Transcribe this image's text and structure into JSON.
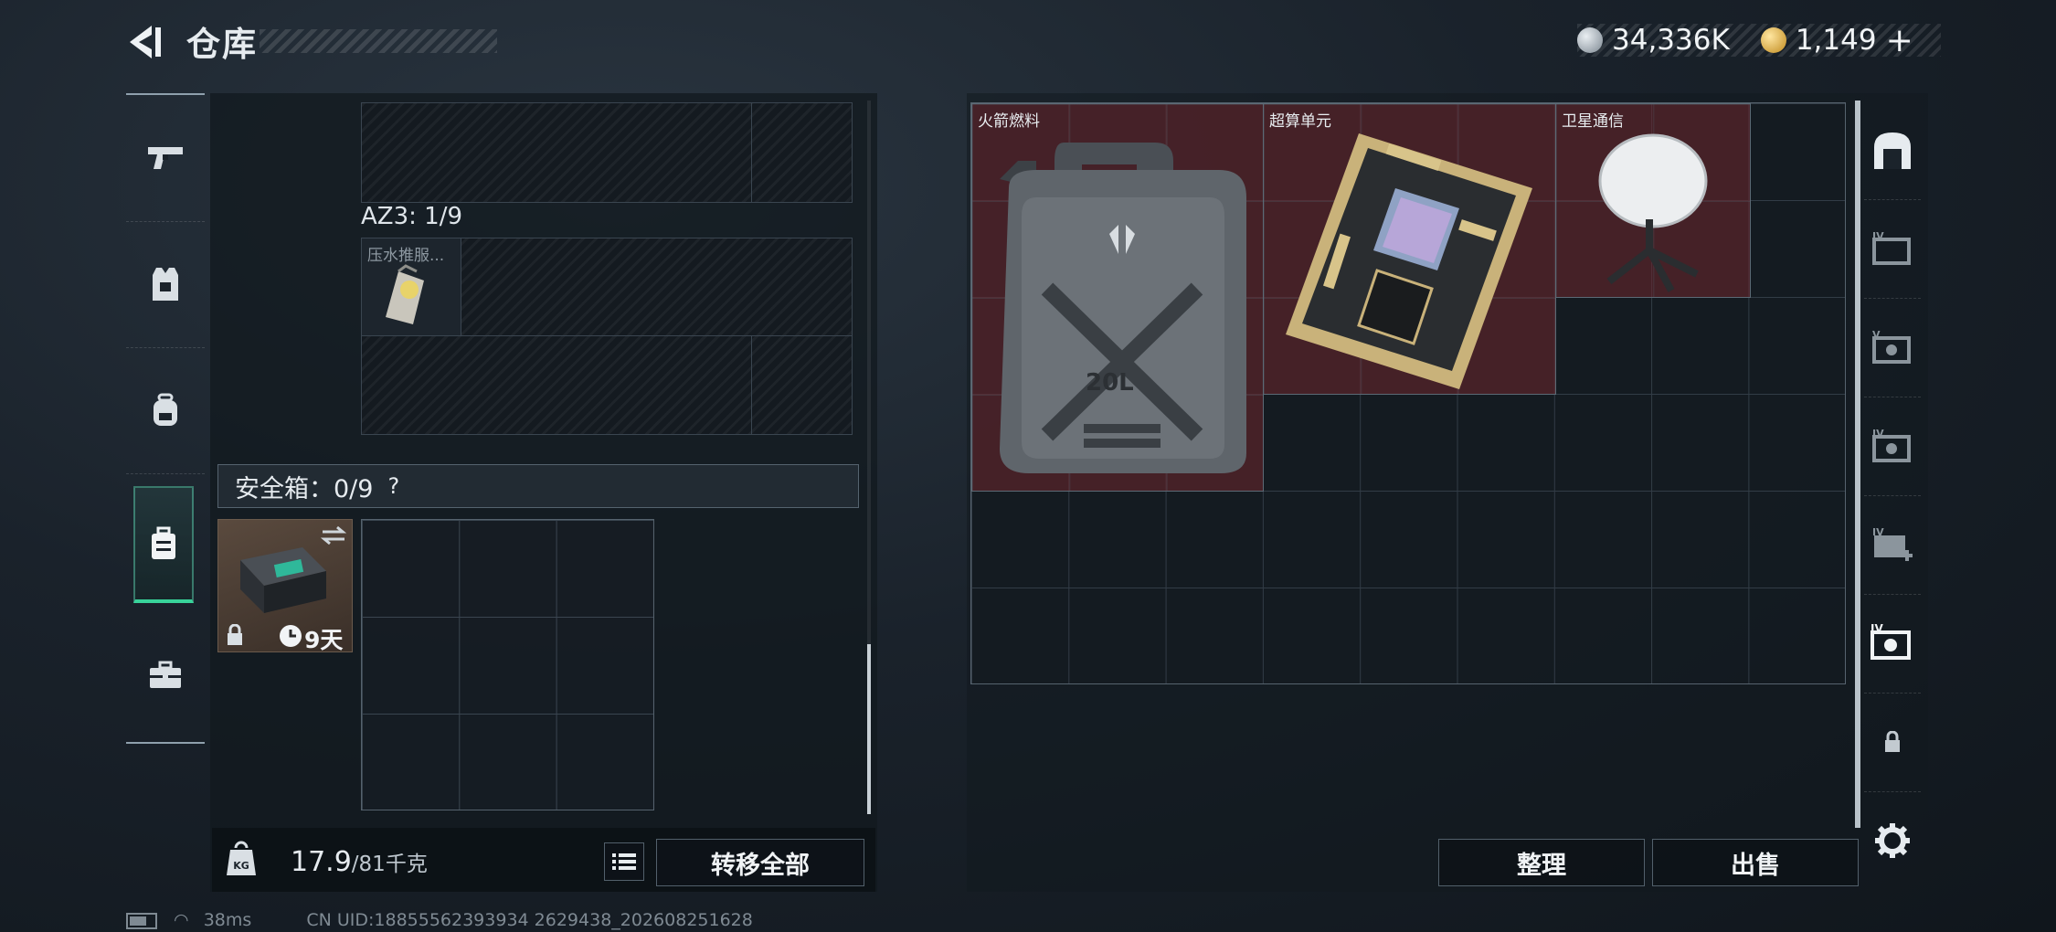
{
  "header": {
    "title": "仓库",
    "back_icon": "back-arrow-icon"
  },
  "currency": {
    "silver": "34,336K",
    "gold": "1,149",
    "plus": "+"
  },
  "left_sidebar": {
    "items": [
      {
        "name": "weapon",
        "icon": "pistol-icon"
      },
      {
        "name": "armor",
        "icon": "vest-icon"
      },
      {
        "name": "backpack",
        "icon": "backpack-icon"
      },
      {
        "name": "safebox",
        "icon": "case-icon",
        "active": true
      },
      {
        "name": "kit",
        "icon": "toolbox-icon"
      }
    ]
  },
  "container": {
    "az3_label": "AZ3: 1/9",
    "az3_item_label": "压水推服..."
  },
  "safebox": {
    "label": "安全箱：0/9",
    "help": "?",
    "time_left": "9天"
  },
  "bottom": {
    "weight_value": "17.9",
    "weight_capacity": "/81千克",
    "transfer_all": "转移全部"
  },
  "stash": {
    "items": [
      {
        "label": "火箭燃料",
        "icon": "jerrycan-icon",
        "badge": "20L"
      },
      {
        "label": "超算单元",
        "icon": "circuit-board-icon"
      },
      {
        "label": "卫星通信",
        "icon": "satellite-dish-icon"
      }
    ],
    "organize_button": "整理",
    "sell_button": "出售"
  },
  "right_sidebar": {
    "tabs": [
      "warehouse-home",
      "stash-3",
      "stash-5",
      "stash-4",
      "stash-add",
      "stash-selected",
      "locked-tab",
      "settings"
    ]
  },
  "footer": {
    "ping": "38ms",
    "uid": "CN UID:18855562393934 2629438_202608251628"
  }
}
